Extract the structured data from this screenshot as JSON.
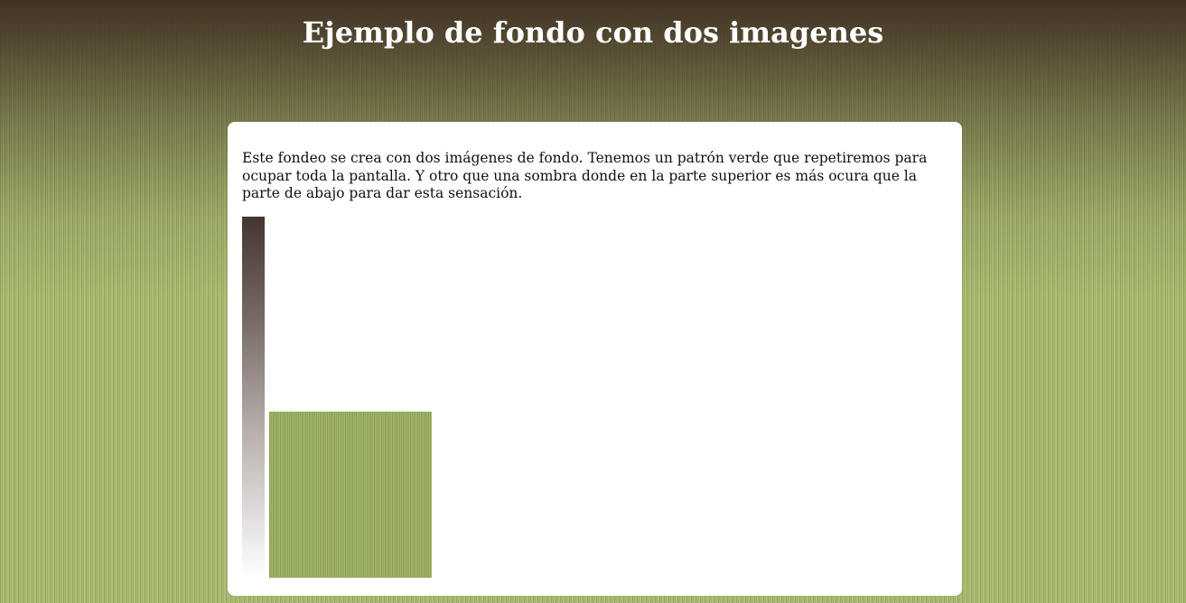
{
  "header": {
    "title": "Ejemplo de fondo con dos imagenes"
  },
  "main": {
    "description": "Este fondeo se crea con dos imágenes de fondo. Tenemos un patrón verde que repetiremos para ocupar toda la pantalla. Y otro que una sombra donde en la parte superior es más ocura que la parte de abajo para dar esta sensación."
  },
  "colors": {
    "background_green": "#a5b86a",
    "shadow_dark": "#433630",
    "card_background": "#ffffff",
    "title_text": "#ffffff"
  }
}
